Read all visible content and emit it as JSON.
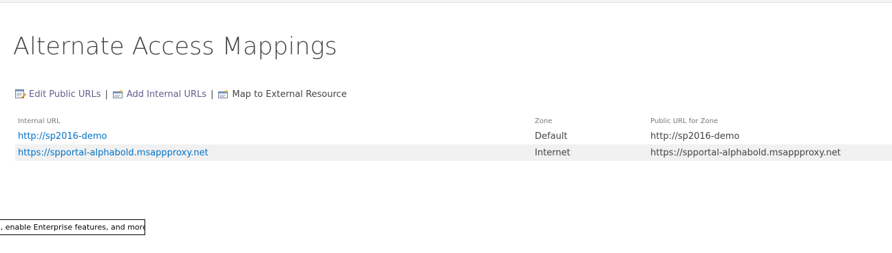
{
  "page": {
    "title": "Alternate Access Mappings"
  },
  "toolbar": {
    "edit_public_urls": "Edit Public URLs",
    "add_internal_urls": "Add Internal URLs",
    "map_external": "Map to External Resource",
    "separator": "|"
  },
  "table": {
    "headers": {
      "internal_url": "Internal URL",
      "zone": "Zone",
      "public_url": "Public URL for Zone"
    },
    "rows": [
      {
        "internal_url": "http://sp2016-demo",
        "zone": "Default",
        "public_url": "http://sp2016-demo"
      },
      {
        "internal_url": "https://spportal-alphabold.msappproxy.net",
        "zone": "Internet",
        "public_url": "https://spportal-alphabold.msappproxy.net"
      }
    ]
  },
  "tooltip": {
    "text": "s, enable Enterprise features, and more"
  },
  "colors": {
    "link": "#0072c6",
    "toolbar_link": "#605e8a",
    "row_alt": "#f1f1f1",
    "text": "#444444"
  },
  "icons": {
    "edit": "edit-list-icon",
    "add": "add-list-icon",
    "map": "map-external-icon"
  }
}
